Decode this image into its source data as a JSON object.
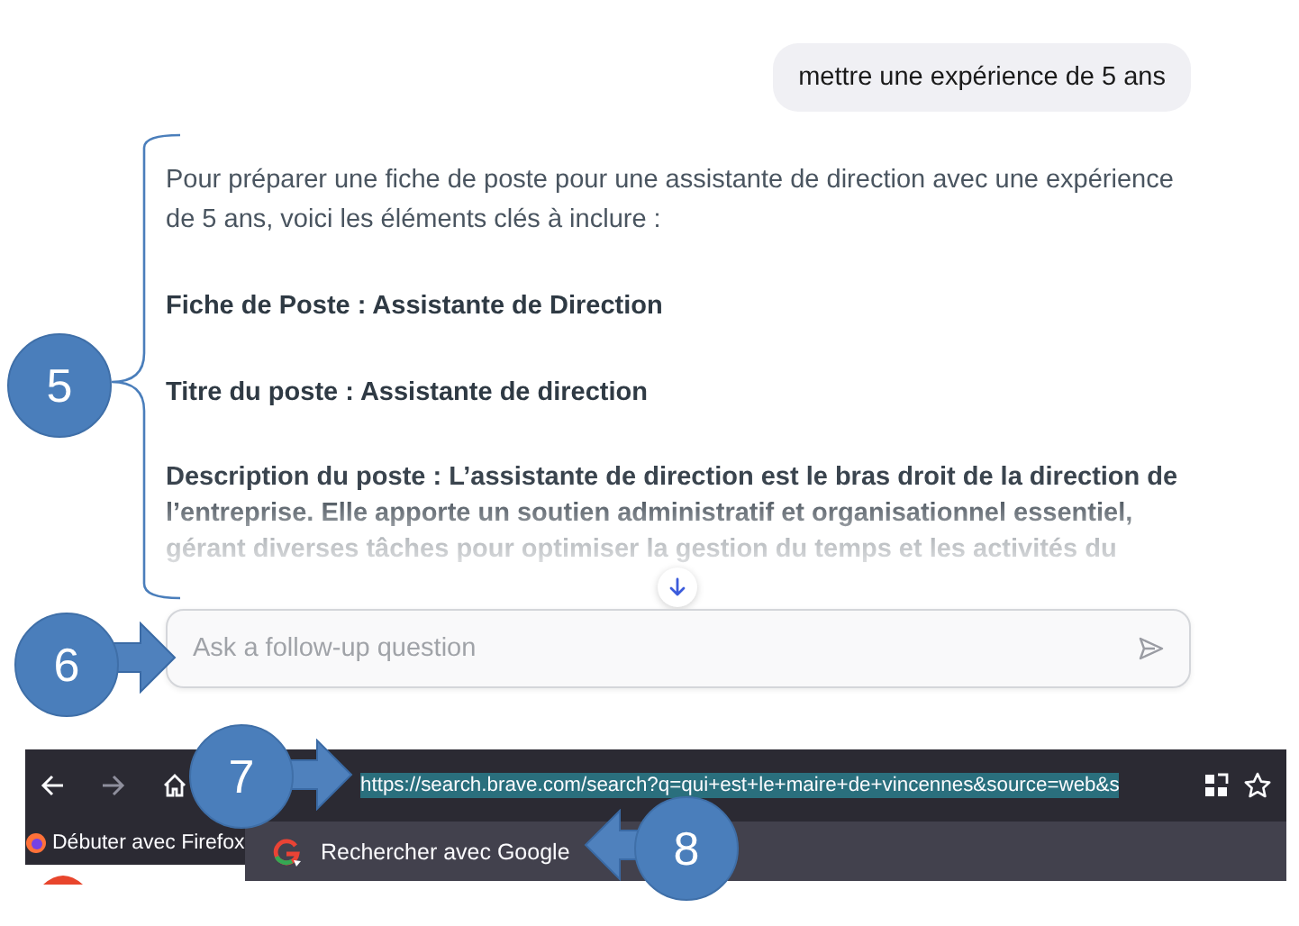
{
  "chat": {
    "user_message": "mettre une expérience de 5 ans",
    "answer": [
      {
        "kind": "normal",
        "text": "Pour préparer une fiche de poste pour une assistante de direction avec une expérience de 5 ans, voici les éléments clés à inclure :"
      },
      {
        "kind": "heading",
        "text": "Fiche de Poste : Assistante de Direction"
      },
      {
        "kind": "heading",
        "text": "Titre du poste : Assistante de direction"
      },
      {
        "kind": "faded",
        "text": "Description du poste : L’assistante de direction est le bras droit de la direction de l’entreprise. Elle apporte un soutien administratif et organisationnel essentiel, gérant diverses tâches pour optimiser la gestion du temps et les activités du"
      }
    ],
    "follow_up": {
      "placeholder": "Ask a follow-up question"
    }
  },
  "browser": {
    "url": "https://search.brave.com/search?q=qui+est+le+maire+de+vincennes&source=web&s",
    "url_selected": true,
    "bookmark": "Débuter avec Firefox",
    "suggestion": "Rechercher avec Google"
  },
  "callouts": [
    {
      "label": "5"
    },
    {
      "label": "6"
    },
    {
      "label": "7"
    },
    {
      "label": "8"
    }
  ]
}
